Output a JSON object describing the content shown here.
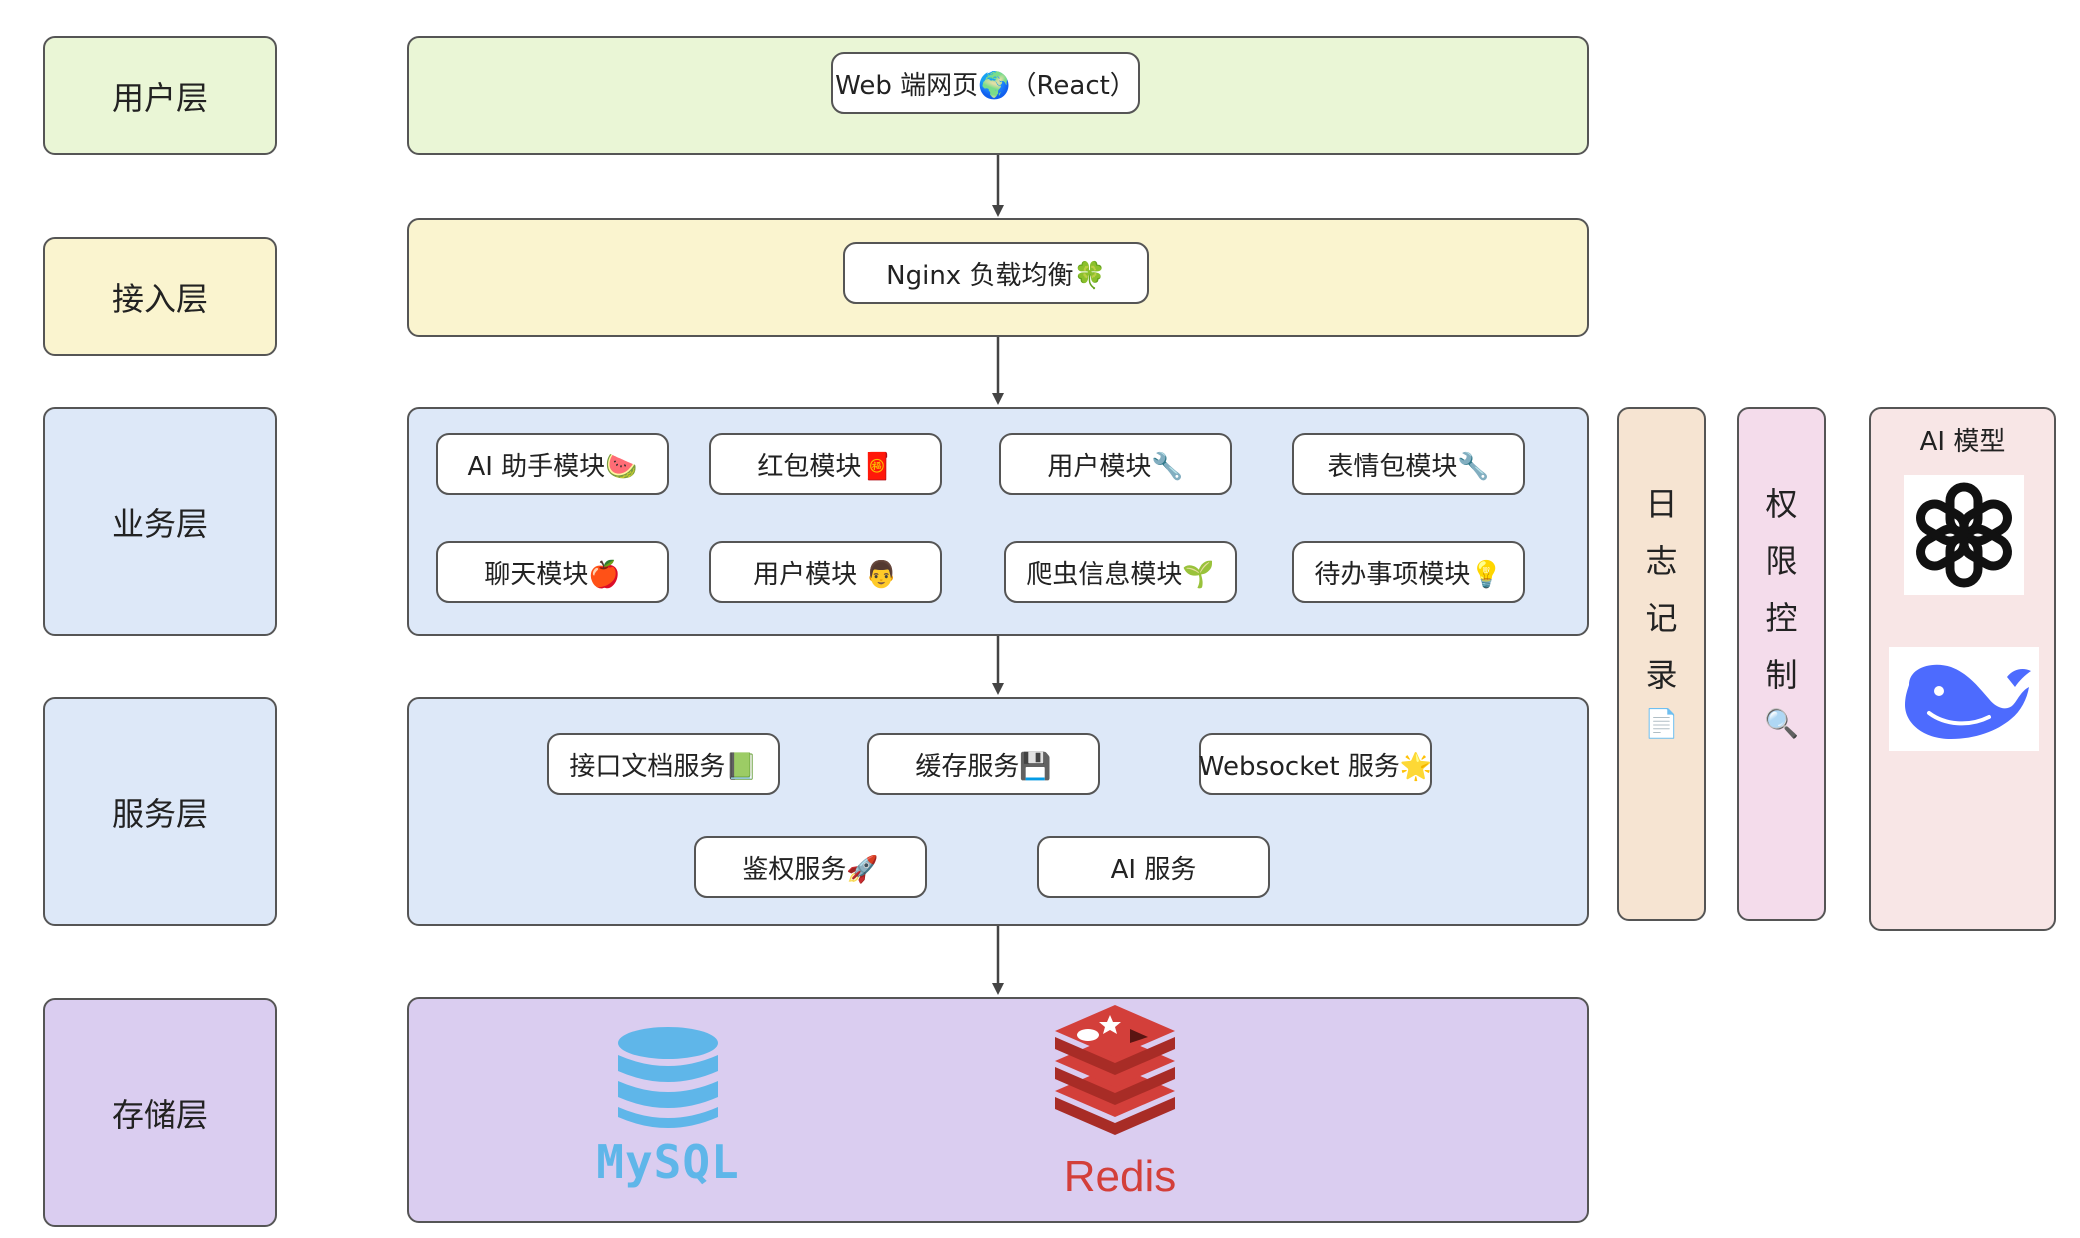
{
  "layers": {
    "user": "用户层",
    "access": "接入层",
    "business": "业务层",
    "service": "服务层",
    "storage": "存储层"
  },
  "user_layer": {
    "web": "Web 端网页🌍（React）"
  },
  "access_layer": {
    "nginx": "Nginx 负载均衡🍀"
  },
  "business_layer": {
    "modules": [
      "AI 助手模块🍉",
      "红包模块🧧",
      "用户模块🔧",
      "表情包模块🔧",
      "聊天模块🍎",
      "用户模块 👨",
      "爬虫信息模块🌱",
      "待办事项模块💡"
    ]
  },
  "service_layer": {
    "services": [
      "接口文档服务📗",
      "缓存服务💾",
      "Websocket 服务🌟",
      "鉴权服务🚀",
      "AI 服务"
    ]
  },
  "storage_layer": {
    "mysql": "MySQL",
    "redis": "Redis"
  },
  "side_columns": {
    "log": [
      "日",
      "志",
      "记",
      "录",
      "📄"
    ],
    "permission": [
      "权",
      "限",
      "控",
      "制",
      "🔍"
    ],
    "ai_models_title": "AI 模型"
  },
  "colors": {
    "user": "#eaf6d6",
    "access": "#faf4cf",
    "business": "#dde8f8",
    "storage": "#dacdf0",
    "log": "#f6e4d2",
    "permission": "#f4dceb",
    "ai_model": "#f8e6e6",
    "mysql": "#5fb6e9",
    "redis": "#d33f3a",
    "deepseek": "#4d6bfe"
  },
  "icons": [
    "openai-logo-icon",
    "deepseek-whale-icon",
    "mysql-database-icon",
    "redis-logo-icon"
  ]
}
